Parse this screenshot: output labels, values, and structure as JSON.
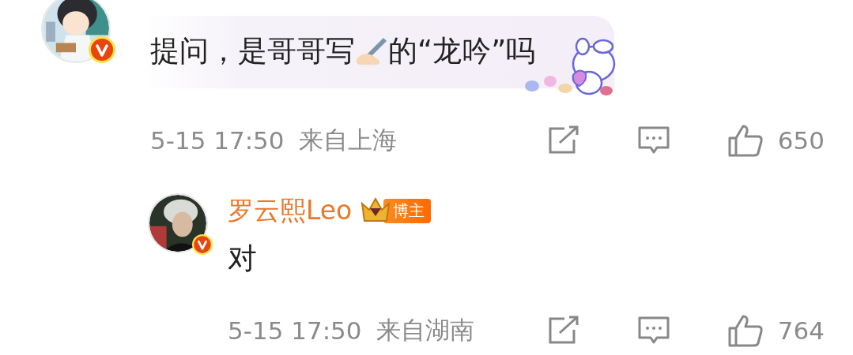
{
  "comments": [
    {
      "avatar": {
        "kind": "picture",
        "verified": true
      },
      "bubble": true,
      "text_before": "提问，是哥哥写",
      "text_after": "的“龙吟”吗",
      "time": "5-15 17:50",
      "location": "来自上海",
      "likes": "650",
      "reply": false
    },
    {
      "avatar": {
        "kind": "picture",
        "verified": true
      },
      "name": "罗云熙Leo",
      "badge": "博主",
      "bubble": false,
      "text_before": "对",
      "time": "5-15 17:50",
      "location": "来自湖南",
      "likes": "764",
      "reply": true
    }
  ]
}
